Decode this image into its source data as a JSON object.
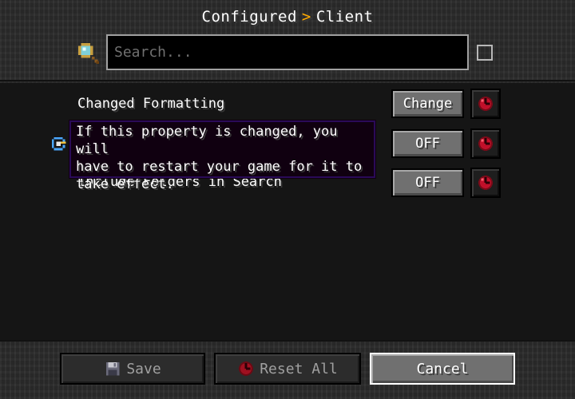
{
  "header": {
    "breadcrumb_parent": "Configured",
    "breadcrumb_separator": ">",
    "breadcrumb_current": "Client",
    "search_placeholder": "Search...",
    "search_value": ""
  },
  "rows": [
    {
      "label": "Changed Formatting",
      "button_label": "Change"
    },
    {
      "label": "",
      "button_label": "OFF"
    },
    {
      "label": "Include Folders in Search",
      "button_label": "OFF"
    }
  ],
  "tooltip": {
    "text": "If this property is changed, you will\nhave to restart your game for it to\ntake effect."
  },
  "footer": {
    "save_label": "Save",
    "reset_all_label": "Reset All",
    "cancel_label": "Cancel"
  },
  "colors": {
    "breadcrumb_separator": "#ffaa00",
    "tooltip_border": "#2a0a58",
    "reset_icon": "#c0102a"
  },
  "icons": {
    "search": "magnifier-icon",
    "filter": "checkbox-icon",
    "reset": "reset-icon",
    "restart": "restart-icon",
    "save": "floppy-disk-icon"
  }
}
